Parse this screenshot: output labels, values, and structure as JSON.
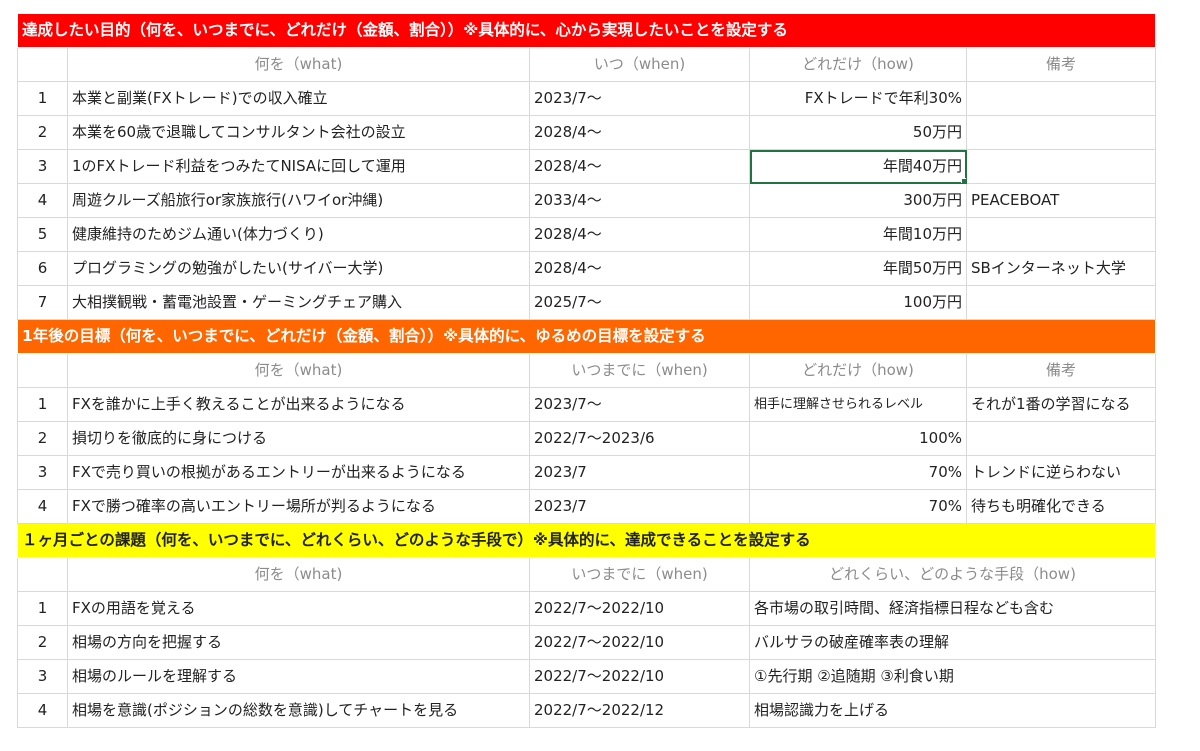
{
  "section1": {
    "title": "達成したい目的（何を、いつまでに、どれだけ（金額、割合））※具体的に、心から実現したいことを設定する",
    "headers": [
      "何を（what)",
      "いつ（when)",
      "どれだけ（how)",
      "備考"
    ],
    "rows": [
      {
        "no": "1",
        "what": "本業と副業(FXトレード)での収入確立",
        "when": "2023/7〜",
        "how": "FXトレードで年利30%",
        "note": ""
      },
      {
        "no": "2",
        "what": "本業を60歳で退職してコンサルタント会社の設立",
        "when": "2028/4〜",
        "how": "50万円",
        "note": ""
      },
      {
        "no": "3",
        "what": "1のFXトレード利益をつみたてNISAに回して運用",
        "when": "2028/4〜",
        "how": "年間40万円",
        "note": ""
      },
      {
        "no": "4",
        "what": "周遊クルーズ船旅行or家族旅行(ハワイor沖縄)",
        "when": "2033/4〜",
        "how": "300万円",
        "note": "PEACEBOAT"
      },
      {
        "no": "5",
        "what": "健康維持のためジム通い(体力づくり)",
        "when": "2028/4〜",
        "how": "年間10万円",
        "note": ""
      },
      {
        "no": "6",
        "what": "プログラミングの勉強がしたい(サイバー大学)",
        "when": "2028/4〜",
        "how": "年間50万円",
        "note": "SBインターネット大学"
      },
      {
        "no": "7",
        "what": "大相撲観戦・蓄電池設置・ゲーミングチェア購入",
        "when": "2025/7〜",
        "how": "100万円",
        "note": ""
      }
    ]
  },
  "section2": {
    "title": "1年後の目標（何を、いつまでに、どれだけ（金額、割合））※具体的に、ゆるめの目標を設定する",
    "headers": [
      "何を（what)",
      "いつまでに（when)",
      "どれだけ（how)",
      "備考"
    ],
    "rows": [
      {
        "no": "1",
        "what": "FXを誰かに上手く教えることが出来るようになる",
        "when": "2023/7〜",
        "how": "相手に理解させられるレベル",
        "note": "それが1番の学習になる"
      },
      {
        "no": "2",
        "what": "損切りを徹底的に身につける",
        "when": "2022/7〜2023/6",
        "how": "100%",
        "note": ""
      },
      {
        "no": "3",
        "what": "FXで売り買いの根拠があるエントリーが出来るようになる",
        "when": "2023/7",
        "how": "70%",
        "note": "トレンドに逆らわない"
      },
      {
        "no": "4",
        "what": "FXで勝つ確率の高いエントリー場所が判るようになる",
        "when": "2023/7",
        "how": "70%",
        "note": "待ちも明確化できる"
      }
    ]
  },
  "section3": {
    "title": "１ヶ月ごとの課題（何を、いつまでに、どれくらい、どのような手段で）※具体的に、達成できることを設定する",
    "headers": [
      "何を（what)",
      "いつまでに（when)",
      "どれくらい、どのような手段（how)"
    ],
    "rows": [
      {
        "no": "1",
        "what": "FXの用語を覚える",
        "when": "2022/7〜2022/10",
        "how": "各市場の取引時間、経済指標日程なども含む"
      },
      {
        "no": "2",
        "what": "相場の方向を把握する",
        "when": "2022/7〜2022/10",
        "how": "バルサラの破産確率表の理解"
      },
      {
        "no": "3",
        "what": "相場のルールを理解する",
        "when": "2022/7〜2022/10",
        "how": "①先行期 ②追随期 ③利食い期"
      },
      {
        "no": "4",
        "what": "相場を意識(ポジションの総数を意識)してチャートを見る",
        "when": "2022/7〜2022/12",
        "how": "相場認識力を上げる"
      }
    ]
  }
}
